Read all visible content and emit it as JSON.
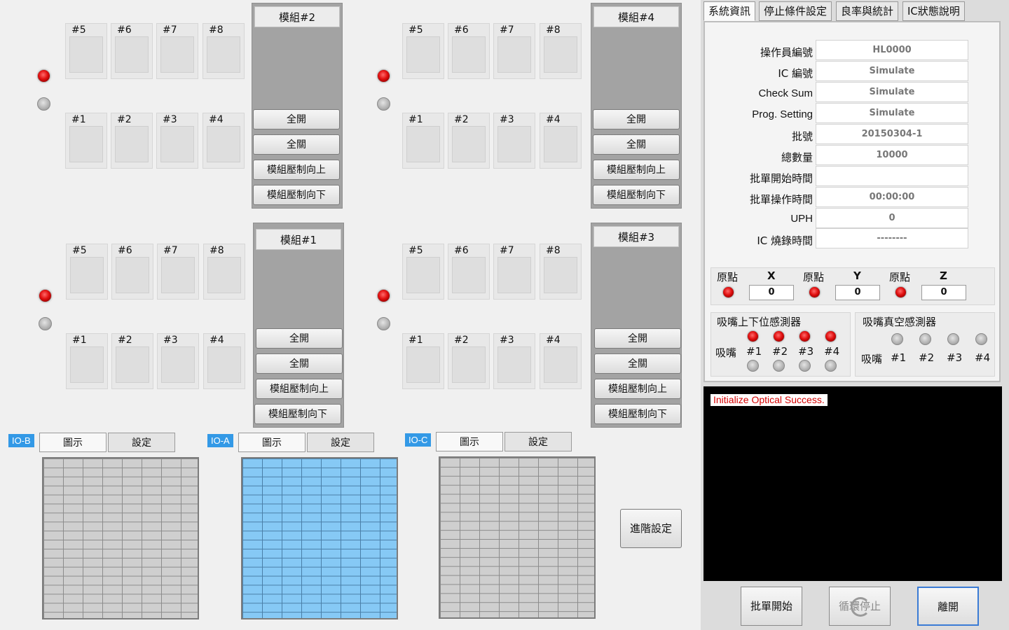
{
  "modules": {
    "m2": {
      "title": "模組#2",
      "open_all": "全開",
      "close_all": "全關",
      "press_up": "模組壓制向上",
      "press_down": "模組壓制向下"
    },
    "m4": {
      "title": "模組#4",
      "open_all": "全開",
      "close_all": "全關",
      "press_up": "模組壓制向上",
      "press_down": "模組壓制向下"
    },
    "m1": {
      "title": "模組#1",
      "open_all": "全開",
      "close_all": "全關",
      "press_up": "模組壓制向上",
      "press_down": "模組壓制向下"
    },
    "m3": {
      "title": "模組#3",
      "open_all": "全開",
      "close_all": "全關",
      "press_up": "模組壓制向上",
      "press_down": "模組壓制向下"
    }
  },
  "socket_labels": {
    "top": [
      "#5",
      "#6",
      "#7",
      "#8"
    ],
    "bottom": [
      "#1",
      "#2",
      "#3",
      "#4"
    ]
  },
  "io": {
    "b": {
      "tag": "IO-B",
      "tab_view": "圖示",
      "tab_settings": "設定"
    },
    "a": {
      "tag": "IO-A",
      "tab_view": "圖示",
      "tab_settings": "設定"
    },
    "c": {
      "tag": "IO-C",
      "tab_view": "圖示",
      "tab_settings": "設定"
    }
  },
  "advanced_settings": "進階設定",
  "right_tabs": [
    "系統資訊",
    "停止條件設定",
    "良率與統計",
    "IC狀態說明"
  ],
  "info": {
    "operator_label": "操作員編號",
    "operator_value": "HL0000",
    "ic_label": "IC 編號",
    "ic_value": "Simulate",
    "checksum_label": "Check Sum",
    "checksum_value": "Simulate",
    "prog_label": "Prog. Setting",
    "prog_value": "Simulate",
    "batch_label": "批號",
    "batch_value": "20150304-1",
    "total_label": "總數量",
    "total_value": "10000",
    "start_label": "批單開始時間",
    "start_value": "",
    "optime_label": "批單操作時間",
    "optime_value": "00:00:00",
    "uph_label": "UPH",
    "uph_value": "0",
    "burn_label": "IC 燒錄時間",
    "burn_value": "--------"
  },
  "axes": {
    "origin_label": "原點",
    "x_label": "X",
    "x_value": "0",
    "y_label": "Y",
    "y_value": "0",
    "z_label": "Z",
    "z_value": "0"
  },
  "nozzle_updown": {
    "title": "吸嘴上下位感測器",
    "row_label": "吸嘴",
    "items": [
      "#1",
      "#2",
      "#3",
      "#4"
    ]
  },
  "nozzle_vacuum": {
    "title": "吸嘴真空感測器",
    "row_label": "吸嘴",
    "items": [
      "#1",
      "#2",
      "#3",
      "#4"
    ]
  },
  "console_message": "Initialize Optical Success.",
  "bottom_buttons": {
    "batch_start": "批單開始",
    "loop_stop": "循環停止",
    "exit": "離開"
  },
  "colors": {
    "led_on": "#e01010",
    "led_off": "#b5b5b5",
    "io_a_fill": "#86c9f5",
    "io_tag": "#3399e6",
    "console_text": "#d40000"
  }
}
